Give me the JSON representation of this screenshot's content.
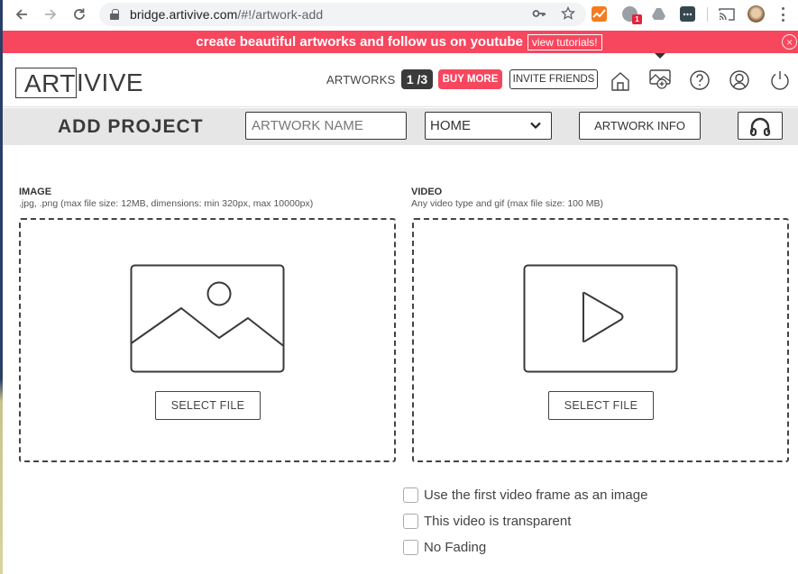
{
  "browser": {
    "url_host": "bridge.artivive.com",
    "url_path": "/#!/artwork-add",
    "extension_badge": "1"
  },
  "banner": {
    "text": "create beautiful artworks and follow us on youtube",
    "button_label": "view tutorials!",
    "close_icon": "×",
    "color": "#f6475f"
  },
  "header": {
    "logo_boxed": "ART",
    "logo_rest": "IVIVE",
    "artworks_label": "ARTWORKS",
    "artworks_count": "1 /3",
    "buy_more_label": "BUY MORE",
    "invite_friends_label": "INVITE FRIENDS",
    "nav_icons": [
      "home-icon",
      "add-artwork-icon",
      "help-icon",
      "account-icon",
      "power-icon"
    ],
    "accent_color": "#f6475f"
  },
  "subheader": {
    "title": "ADD PROJECT",
    "artwork_name_placeholder": "ARTWORK NAME",
    "artwork_name_value": "",
    "category_selected": "HOME",
    "artwork_info_label": "ARTWORK INFO",
    "support_icon": "headphones-icon"
  },
  "image_section": {
    "title": "IMAGE",
    "description": ".jpg, .png (max file size: 12MB, dimensions: min 320px, max 10000px)",
    "select_label": "SELECT FILE"
  },
  "video_section": {
    "title": "VIDEO",
    "description": "Any video type and gif (max file size: 100 MB)",
    "select_label": "SELECT FILE"
  },
  "options": [
    {
      "label": "Use the first video frame as an image",
      "checked": false
    },
    {
      "label": "This video is transparent",
      "checked": false
    },
    {
      "label": "No Fading",
      "checked": false
    }
  ]
}
